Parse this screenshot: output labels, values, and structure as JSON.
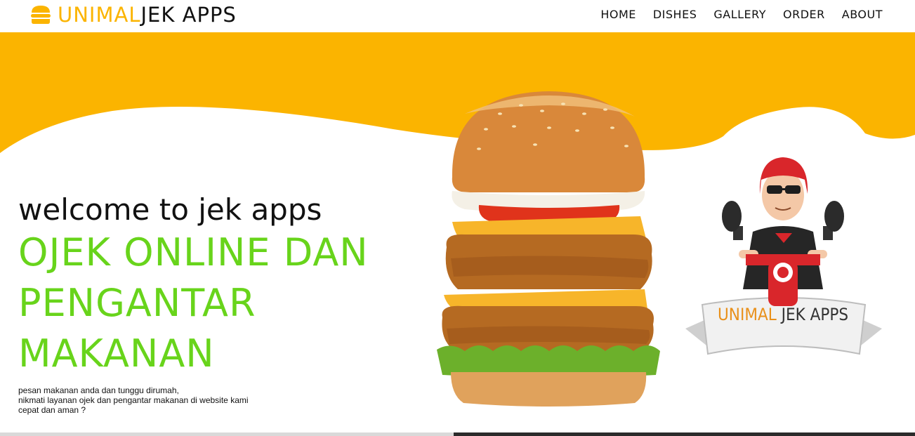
{
  "brand": {
    "accent": "UNIMAL",
    "rest": "JEK APPS"
  },
  "nav": [
    "HOME",
    "DISHES",
    "GALLERY",
    "ORDER",
    "ABOUT"
  ],
  "hero": {
    "welcome": "welcome to jek apps",
    "headline": [
      "OJEK ONLINE DAN",
      "PENGANTAR",
      "MAKANAN"
    ],
    "description": [
      "pesan makanan anda dan tunggu dirumah,",
      "nikmati layanan ojek dan pengantar makanan di website kami",
      "cepat dan aman ?"
    ]
  },
  "badge": {
    "accent": "UNIMAL",
    "rest": "JEK APPS"
  },
  "icons": {
    "logo": "burger-icon",
    "hero": "burger-image",
    "badge": "courier-mascot"
  },
  "colors": {
    "accent": "#fbb400",
    "headline": "#68d41b",
    "text": "#111111"
  }
}
